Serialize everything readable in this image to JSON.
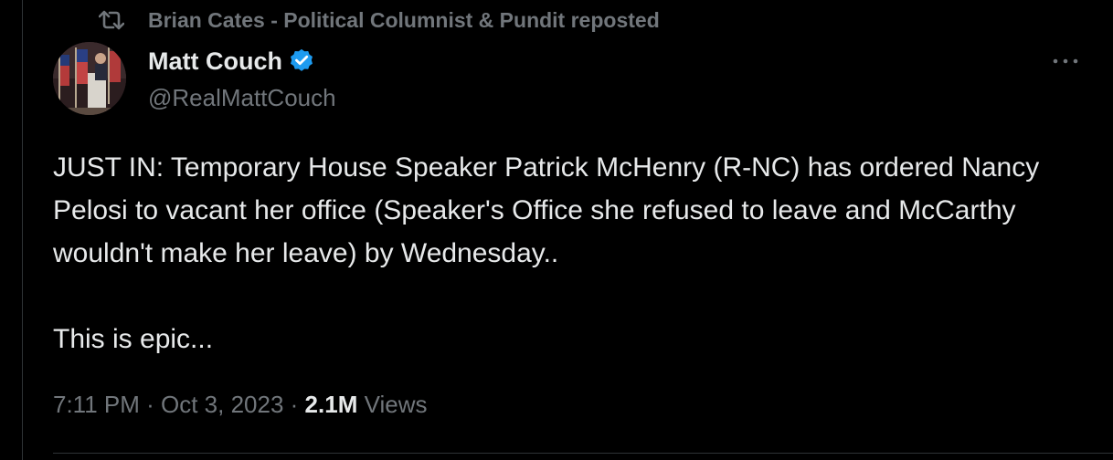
{
  "repost": {
    "icon": "repost-icon",
    "text": "Brian Cates - Political Columnist & Pundit reposted"
  },
  "author": {
    "display_name": "Matt Couch",
    "handle": "@RealMattCouch",
    "verified": true,
    "verified_icon": "verified-badge-icon",
    "verified_color": "#1d9bf0"
  },
  "more_icon": "more-horizontal-icon",
  "tweet": {
    "paragraphs": [
      "JUST IN: Temporary House Speaker Patrick McHenry (R-NC) has ordered Nancy Pelosi to vacant her office (Speaker's Office she refused to leave and McCarthy wouldn't make her leave) by Wednesday..",
      "This is epic..."
    ]
  },
  "meta": {
    "time": "7:11 PM",
    "separator": " · ",
    "date": "Oct 3, 2023",
    "views_count": "2.1M",
    "views_label": " Views"
  },
  "colors": {
    "background": "#000000",
    "text_primary": "#e7e9ea",
    "text_secondary": "#71767b",
    "divider": "#2f3336"
  }
}
